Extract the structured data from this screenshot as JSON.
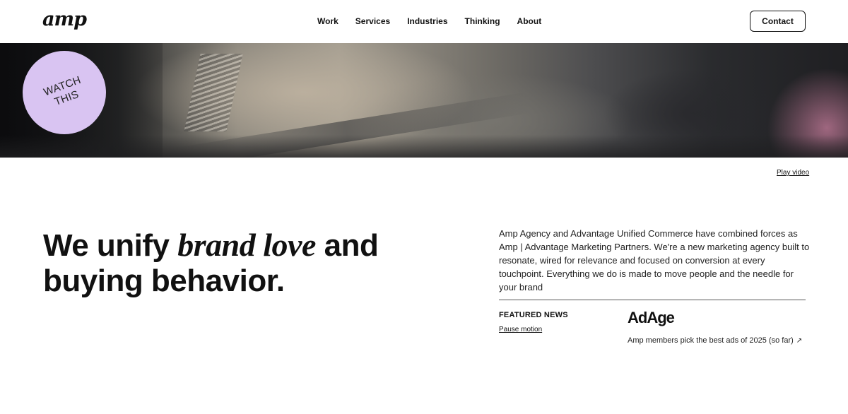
{
  "header": {
    "logo": "amp",
    "nav": [
      "Work",
      "Services",
      "Industries",
      "Thinking",
      "About"
    ],
    "contact_label": "Contact"
  },
  "hero": {
    "watch_line1": "WATCH",
    "watch_line2": "THIS",
    "play_video": "Play video",
    "badge_color": "#d9c4f2"
  },
  "main": {
    "headline_part1": "We unify ",
    "headline_italic": "brand love",
    "headline_part2": " and buying behavior.",
    "description": "Amp Agency and Advantage Unified Commerce have combined forces as Amp | Advantage Marketing Partners. We're a new marketing agency built to resonate, wired for relevance and focused on conversion at every touchpoint. Everything we do is made to move people and the needle for your brand"
  },
  "news": {
    "featured_label": "FEATURED NEWS",
    "pause_label": "Pause motion",
    "source_logo": "AdAge",
    "headline": "Amp members pick the best ads of 2025 (so far)",
    "link_icon": "external-arrow-icon"
  }
}
